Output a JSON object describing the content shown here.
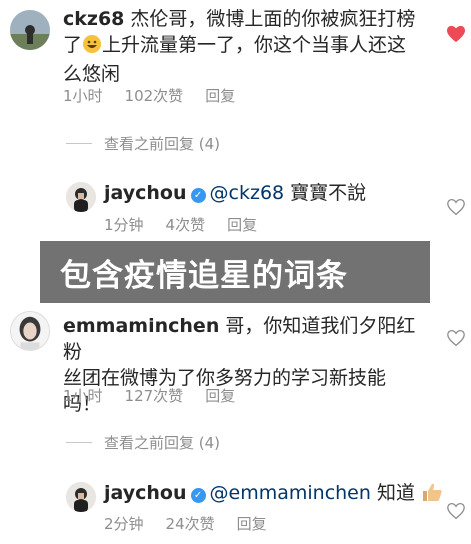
{
  "comments": [
    {
      "username": "ckz68",
      "text_line1": "杰伦哥，微博上面的你被疯狂打榜",
      "text_line2a": "了",
      "text_line2b": "上升流量第一了，你这个当事人还这",
      "text_line3": "么悠闲",
      "time": "1小时",
      "likes": "102次赞",
      "reply": "回复",
      "view_replies": "查看之前回复 (4)",
      "heart_color": "#ed4956"
    },
    {
      "username": "jaychou",
      "mention": "@ckz68",
      "text": "寶寶不說",
      "time": "1分钟",
      "likes": "4次赞",
      "reply": "回复"
    },
    {
      "username": "emmaminchen",
      "text_line1": "哥，你知道我们夕阳红粉",
      "text_line2": "丝团在微博为了你多努力的学习新技能",
      "text_line3": "吗！",
      "time": "1小时",
      "likes": "127次赞",
      "reply": "回复",
      "view_replies": "查看之前回复 (4)"
    },
    {
      "username": "jaychou",
      "mention": "@emmaminchen",
      "text": "知道",
      "time": "2分钟",
      "likes": "24次赞",
      "reply": "回复"
    }
  ],
  "banner": {
    "text": "包含疫情追星的词条"
  },
  "icons": {
    "heart": "heart-icon",
    "verified": "verified-badge-icon",
    "emoji": "grinning-emoji-icon",
    "thumbs": "thumbs-up-emoji-icon"
  },
  "colors": {
    "liked": "#ed4956",
    "verified": "#3897f0",
    "meta": "#8e8e8e"
  }
}
